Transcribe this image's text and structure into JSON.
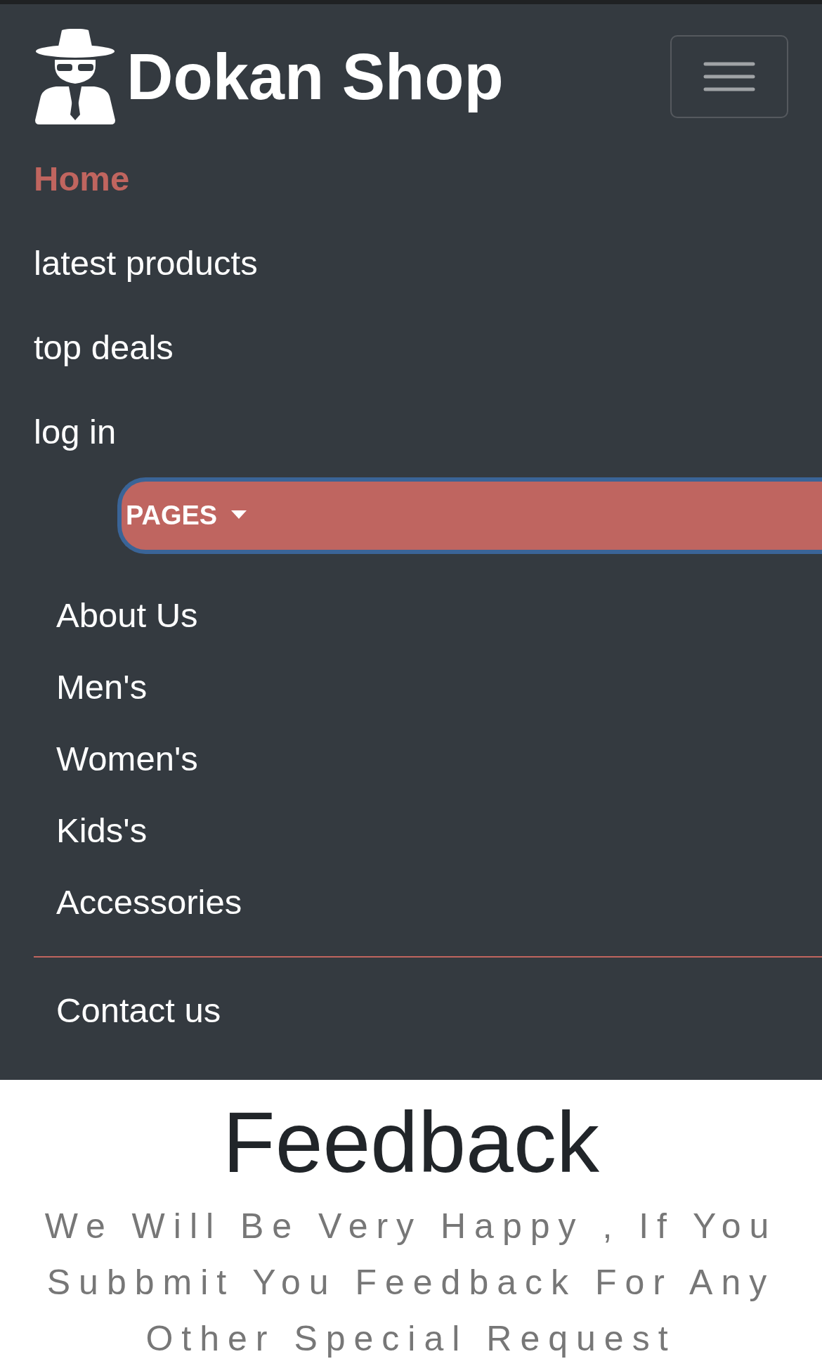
{
  "navbar": {
    "brand": "Dokan Shop",
    "nav_items": [
      {
        "label": "Home",
        "selected": true
      },
      {
        "label": "latest products",
        "selected": false
      },
      {
        "label": "top deals",
        "selected": false
      },
      {
        "label": "log in",
        "selected": false
      }
    ],
    "dropdown": {
      "label": "PAGES",
      "expanded": true,
      "items": [
        "About Us",
        "Men's",
        "Women's",
        "Kids's",
        "Accessories"
      ],
      "footer_items": [
        "Contact us"
      ]
    }
  },
  "feedback": {
    "heading": "Feedback",
    "text": "We Will Be Very Happy , If You Subbmit You Feedback For Any Other Special Request"
  }
}
